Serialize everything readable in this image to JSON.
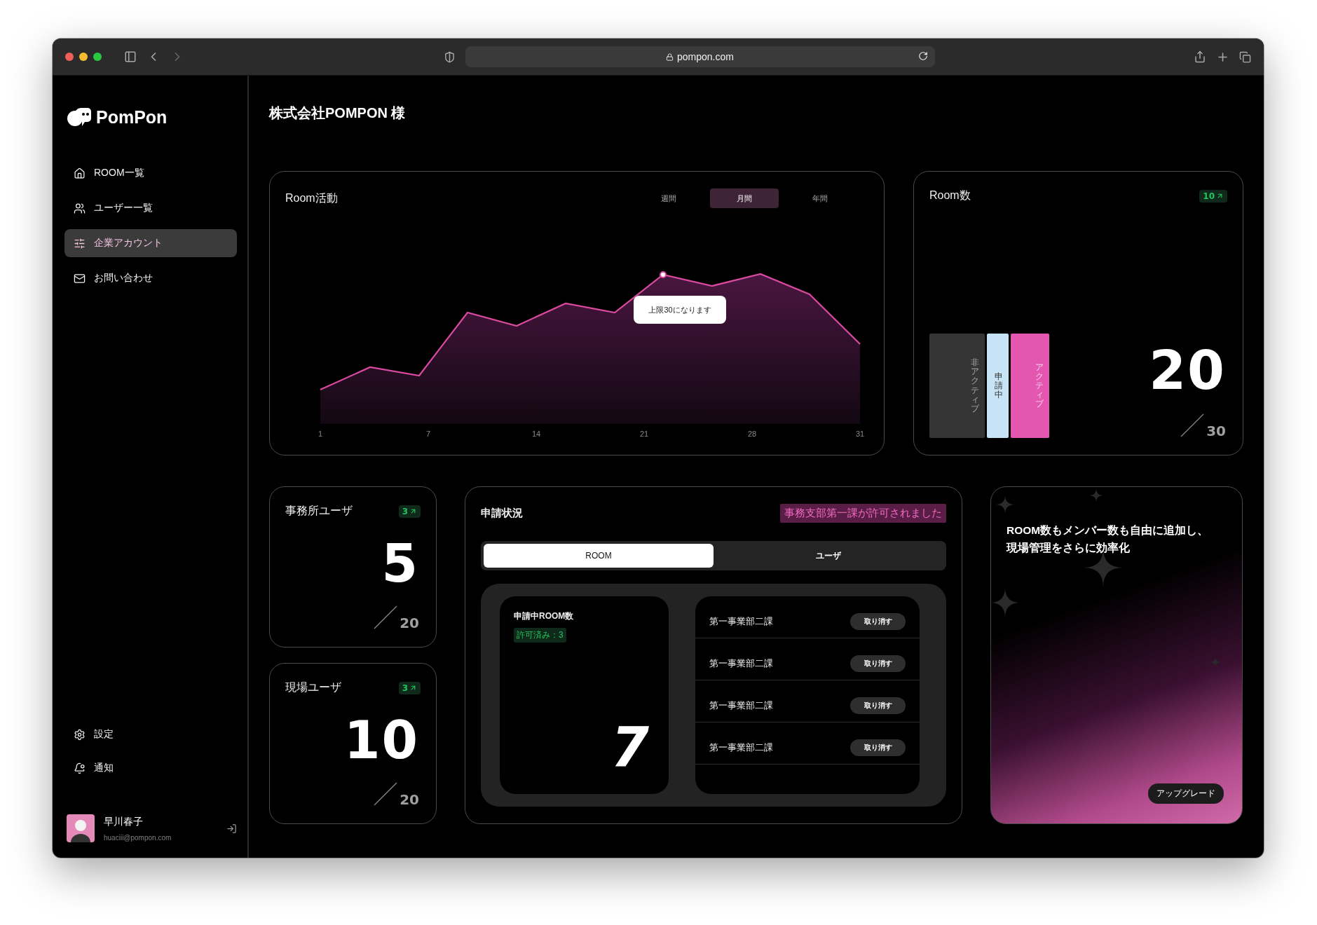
{
  "browser": {
    "url": "pompon.com"
  },
  "sidebar": {
    "logo": "PomPon",
    "nav": [
      {
        "label": "ROOM一覧",
        "selected": false
      },
      {
        "label": "ユーザー一覧",
        "selected": false
      },
      {
        "label": "企業アカウント",
        "selected": true
      },
      {
        "label": "お問い合わせ",
        "selected": false
      }
    ],
    "bottom_nav": [
      {
        "label": "設定"
      },
      {
        "label": "通知"
      }
    ],
    "user": {
      "name": "早川春子",
      "email": "huaciii@pompon.com"
    }
  },
  "page_title": "株式会社POMPON 様",
  "room_activity": {
    "title": "Room活動",
    "periods": [
      {
        "label": "週間",
        "selected": false
      },
      {
        "label": "月間",
        "selected": true
      },
      {
        "label": "年間",
        "selected": false
      }
    ],
    "tooltip": "上限30になります",
    "x_labels": [
      "1",
      "7",
      "14",
      "21",
      "28",
      "31"
    ]
  },
  "room_count": {
    "title": "Room数",
    "badge": "10",
    "segments": [
      {
        "label": "非アクティブ",
        "color": "#353535"
      },
      {
        "label": "申請中",
        "color": "#c6e4f6"
      },
      {
        "label": "アクティブ",
        "color": "#e457b1"
      }
    ],
    "value": "20",
    "limit": "30"
  },
  "user_stats": [
    {
      "title": "事務所ユーザ",
      "badge": "3",
      "value": "5",
      "limit": "20"
    },
    {
      "title": "現場ユーザ",
      "badge": "3",
      "value": "10",
      "limit": "20"
    }
  ],
  "applications": {
    "title": "申請状況",
    "notice": "事務支部第一課が許可されました",
    "tabs": [
      {
        "label": "ROOM",
        "selected": true
      },
      {
        "label": "ユーザ",
        "selected": false
      }
    ],
    "pending": {
      "title": "申請中ROOM数",
      "approved": "許可済み：3",
      "value": "7"
    },
    "rows": [
      {
        "name": "第一事業部二課",
        "action": "取り消す"
      },
      {
        "name": "第一事業部二課",
        "action": "取り消す"
      },
      {
        "name": "第一事業部二課",
        "action": "取り消す"
      },
      {
        "name": "第一事業部二課",
        "action": "取り消す"
      }
    ]
  },
  "promo": {
    "lines": [
      "ROOM数もメンバー数も自由に追加し、",
      "現場管理をさらに効率化"
    ],
    "button": "アップグレード"
  }
}
